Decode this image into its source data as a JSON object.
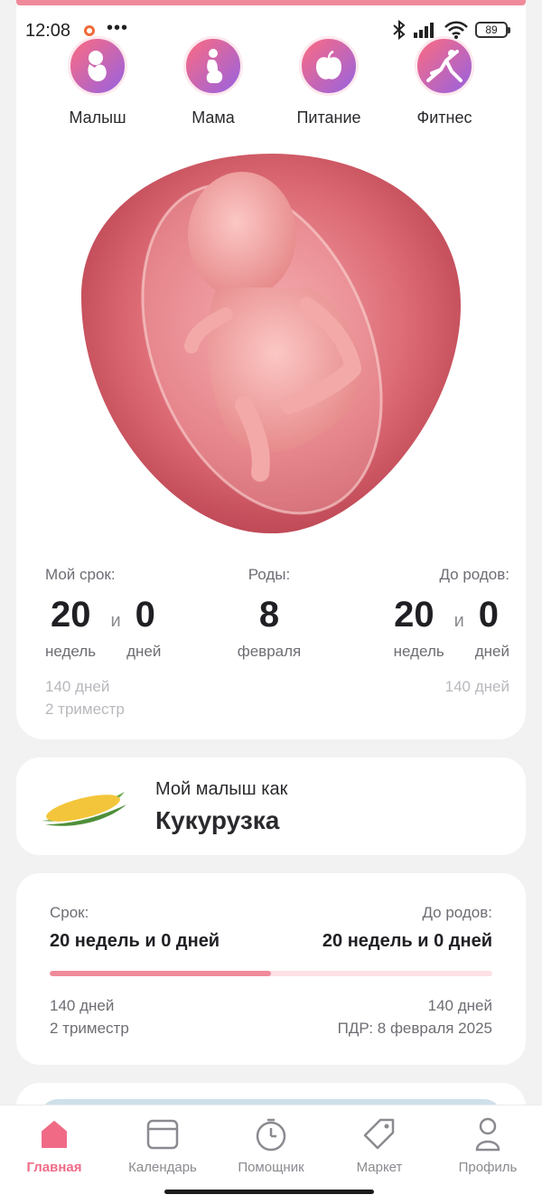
{
  "status_bar": {
    "time": "12:08",
    "dots": "•••",
    "battery": "89"
  },
  "categories": [
    {
      "label": "Малыш",
      "icon": "baby-icon"
    },
    {
      "label": "Мама",
      "icon": "pregnant-woman-icon"
    },
    {
      "label": "Питание",
      "icon": "apple-icon"
    },
    {
      "label": "Фитнес",
      "icon": "fitness-icon"
    }
  ],
  "fetus_image": "fetus-image",
  "stats": {
    "term": {
      "heading": "Мой срок:",
      "weeks": "20",
      "and": "и",
      "days": "0",
      "weeks_unit": "недель",
      "days_unit": "дней",
      "total_days": "140 дней",
      "trimester": "2 триместр"
    },
    "birth": {
      "heading": "Роды:",
      "day": "8",
      "month": "февраля"
    },
    "until": {
      "heading": "До родов:",
      "weeks": "20",
      "and": "и",
      "days": "0",
      "weeks_unit": "недель",
      "days_unit": "дней",
      "total_days": "140 дней"
    }
  },
  "baby_size": {
    "subtitle": "Мой малыш как",
    "title": "Кукурузка",
    "icon": "corn-icon"
  },
  "progress_card": {
    "term_label": "Срок:",
    "term_value": "20 недель и 0 дней",
    "until_label": "До родов:",
    "until_value": "20 недель и 0 дней",
    "progress_percent": 50,
    "left_days": "140 дней",
    "left_trimester": "2 триместр",
    "right_days": "140 дней",
    "due_date": "ПДР: 8 февраля 2025"
  },
  "bottom_nav": [
    {
      "label": "Главная",
      "icon": "home-icon",
      "active": true
    },
    {
      "label": "Календарь",
      "icon": "calendar-icon",
      "active": false
    },
    {
      "label": "Помощник",
      "icon": "timer-icon",
      "active": false
    },
    {
      "label": "Маркет",
      "icon": "tag-icon",
      "active": false
    },
    {
      "label": "Профиль",
      "icon": "profile-icon",
      "active": false
    }
  ],
  "colors": {
    "accent": "#f06a86",
    "progress": "#f08a9a",
    "progress_track": "#fde1e6"
  }
}
